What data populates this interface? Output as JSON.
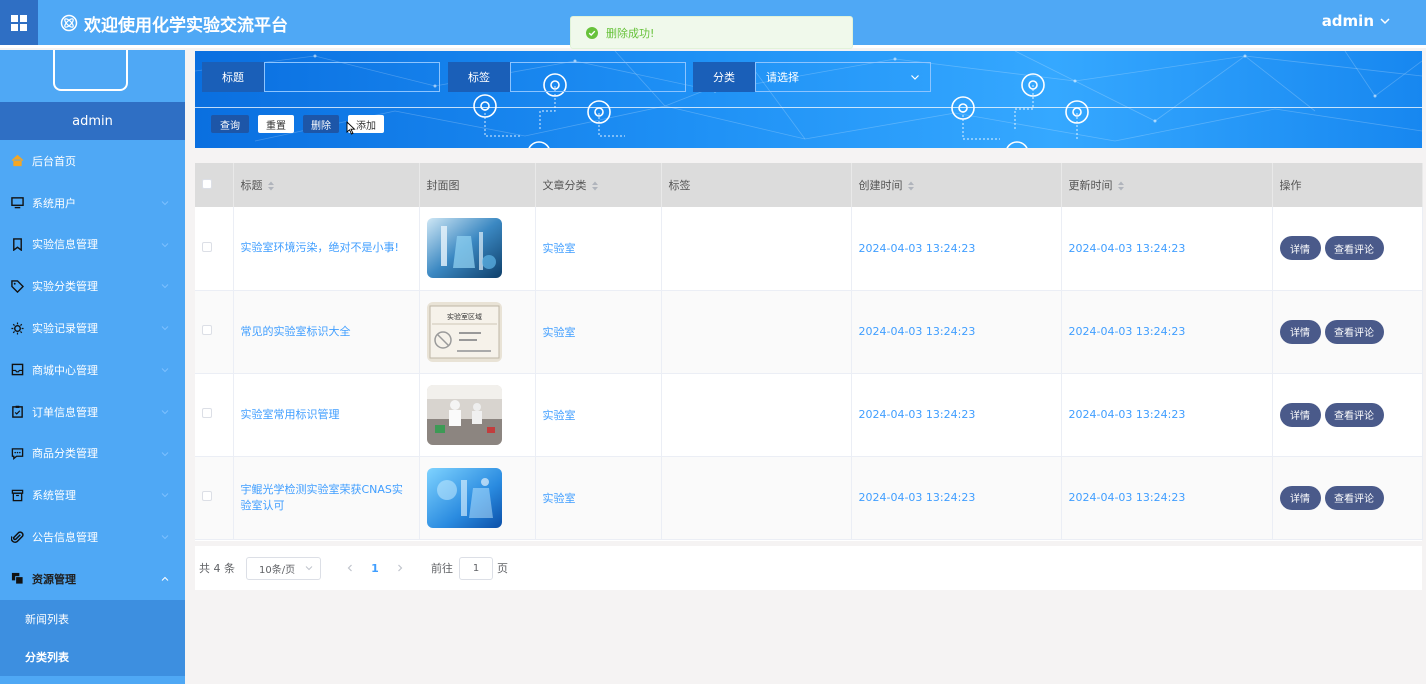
{
  "header": {
    "title": "欢迎使用化学实验交流平台",
    "user": "admin"
  },
  "toast": {
    "message": "删除成功!"
  },
  "sidebar": {
    "username": "admin",
    "items": [
      {
        "label": "后台首页",
        "icon": "home-icon"
      },
      {
        "label": "系统用户",
        "icon": "monitor-icon"
      },
      {
        "label": "实验信息管理",
        "icon": "bookmark-icon"
      },
      {
        "label": "实验分类管理",
        "icon": "tag-icon"
      },
      {
        "label": "实验记录管理",
        "icon": "sun-icon"
      },
      {
        "label": "商城中心管理",
        "icon": "inbox-icon"
      },
      {
        "label": "订单信息管理",
        "icon": "clipboard-icon"
      },
      {
        "label": "商品分类管理",
        "icon": "chat-icon"
      },
      {
        "label": "系统管理",
        "icon": "box-icon"
      },
      {
        "label": "公告信息管理",
        "icon": "paperclip-icon"
      },
      {
        "label": "资源管理",
        "icon": "copy-icon"
      }
    ],
    "subitems": [
      {
        "label": "新闻列表"
      },
      {
        "label": "分类列表"
      }
    ]
  },
  "search": {
    "title_label": "标题",
    "title_value": "",
    "tag_label": "标签",
    "tag_value": "",
    "category_label": "分类",
    "category_placeholder": "请选择",
    "query_btn": "查询",
    "reset_btn": "重置",
    "delete_btn": "删除",
    "add_btn": "添加"
  },
  "table": {
    "columns": [
      "标题",
      "封面图",
      "文章分类",
      "标签",
      "创建时间",
      "更新时间",
      "操作"
    ],
    "rows": [
      {
        "title": "实验室环境污染，绝对不是小事!",
        "category": "实验室",
        "tag": "",
        "created": "2024-04-03 13:24:23",
        "updated": "2024-04-03 13:24:23"
      },
      {
        "title": "常见的实验室标识大全",
        "category": "实验室",
        "tag": "",
        "created": "2024-04-03 13:24:23",
        "updated": "2024-04-03 13:24:23"
      },
      {
        "title": "实验室常用标识管理",
        "category": "实验室",
        "tag": "",
        "created": "2024-04-03 13:24:23",
        "updated": "2024-04-03 13:24:23"
      },
      {
        "title": "宇鲲光学检测实验室荣获CNAS实验室认可",
        "category": "实验室",
        "tag": "",
        "created": "2024-04-03 13:24:23",
        "updated": "2024-04-03 13:24:23"
      }
    ],
    "detail_btn": "详情",
    "comment_btn": "查看评论"
  },
  "pager": {
    "total": "共 4 条",
    "page_size": "10条/页",
    "current": "1",
    "goto_label": "前往",
    "goto_value": "1",
    "goto_suffix": "页"
  },
  "sign": {
    "title": "实验室区域"
  }
}
